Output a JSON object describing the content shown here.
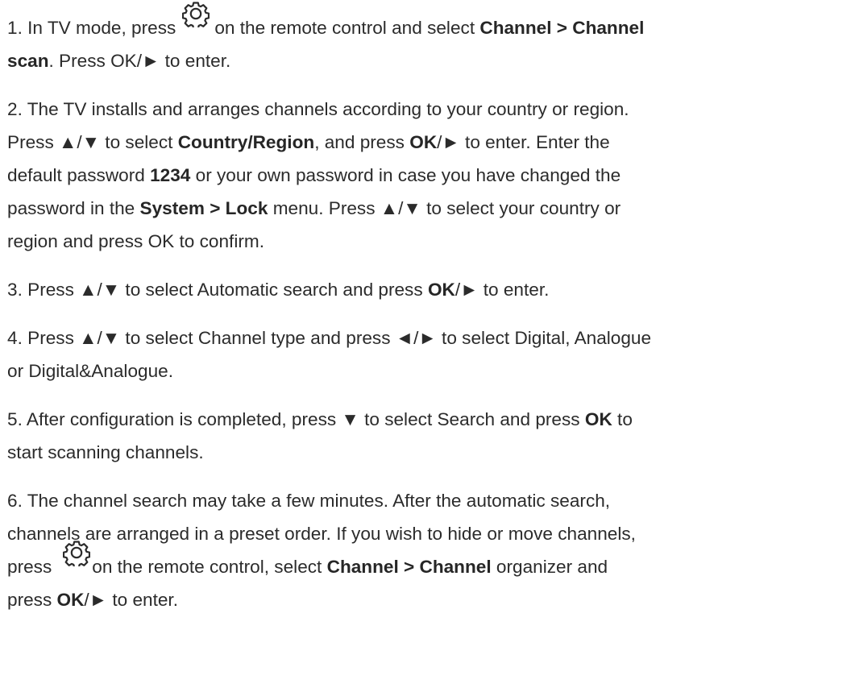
{
  "steps": [
    {
      "number": "1.",
      "pre": "In TV mode, press",
      "post": "on the remote control and select",
      "menu_path": "Channel > Channel",
      "menu_path_tail": "scan",
      "end": ". Press OK/► to enter."
    },
    {
      "number": "2.",
      "line1": "The TV installs and arranges channels according to your country or region.",
      "l2_a": "Press ▲/▼ to select",
      "l2_b": "Country/Region",
      "l2_c": ", and press",
      "l2_d": "OK",
      "l2_e": "/► to enter. Enter the",
      "l3_a": "default password",
      "l3_b": "1234",
      "l3_c": "or your own password in case you have changed the",
      "l4_a": "password in the",
      "l4_b": "System > Lock",
      "l4_c": "menu. Press ▲/▼ to select your country or",
      "line5": "region and press OK to confirm."
    },
    {
      "number": "3.",
      "pre": "Press ▲/▼ to select Automatic search and press",
      "ok": "OK",
      "post": "/► to enter."
    },
    {
      "number": "4.",
      "line1": "Press ▲/▼ to select Channel type and press ◄/► to select Digital, Analogue",
      "line2": "or Digital&Analogue."
    },
    {
      "number": "5.",
      "pre": "After configuration is completed, press ▼ to select Search and press",
      "ok": "OK",
      "post": "to",
      "line2": "start scanning channels."
    },
    {
      "number": "6.",
      "line1": "The channel search may take a few minutes. After the automatic search,",
      "line2": "channels are arranged in a preset order. If you wish to hide or move channels,",
      "l3_a": "press",
      "l3_b": "on the remote control, select",
      "l3_c": "Channel > Channel",
      "l3_d": "organizer and",
      "l4_a": "press",
      "l4_b": "OK",
      "l4_c": "/► to enter."
    }
  ],
  "icons": {
    "settings": "gear-icon"
  }
}
